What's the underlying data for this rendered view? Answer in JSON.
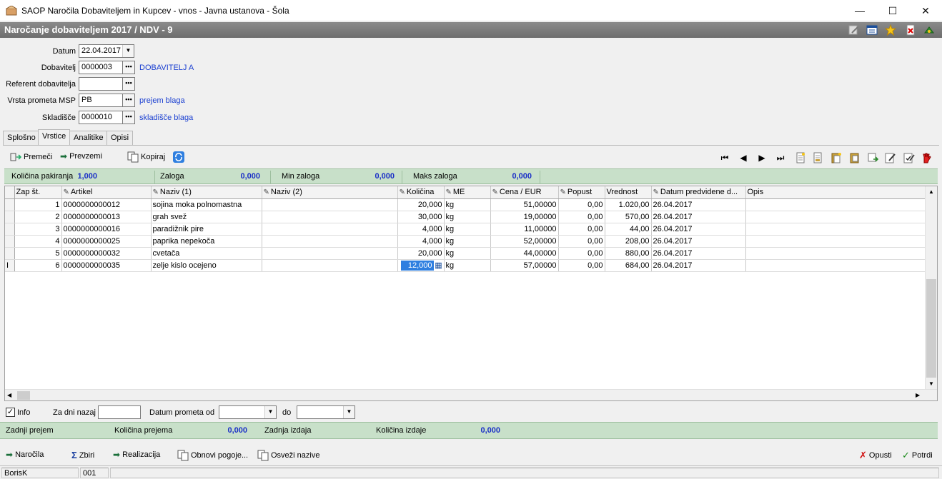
{
  "window": {
    "title": "SAOP  Naročila Dobaviteljem in Kupcev - vnos - Javna ustanova - Šola",
    "minimize": "—",
    "maximize": "☐",
    "close": "✕"
  },
  "header": {
    "title": "Naročanje dobaviteljem 2017 / NDV - 9"
  },
  "form": {
    "datum_label": "Datum",
    "datum_value": "22.04.2017",
    "dobavitelj_label": "Dobavitelj",
    "dobavitelj_value": "0000003",
    "dobavitelj_name": "DOBAVITELJ   A",
    "referent_label": "Referent dobavitelja",
    "referent_value": "",
    "vrsta_label": "Vrsta prometa MSP",
    "vrsta_value": "PB",
    "vrsta_name": "prejem blaga",
    "skladisce_label": "Skladišče",
    "skladisce_value": "0000010",
    "skladisce_name": "skladišče blaga",
    "dots": "•••"
  },
  "tabs": [
    "Splošno",
    "Vrstice",
    "Analitike",
    "Opisi"
  ],
  "toolbar": {
    "premeci": "Premeči",
    "prevzemi": "Prevzemi",
    "kopiraj": "Kopiraj"
  },
  "info": {
    "kolicina_pakiranja_label": "Količina pakiranja",
    "kolicina_pakiranja_value": "1,000",
    "zaloga_label": "Zaloga",
    "zaloga_value": "0,000",
    "min_zaloga_label": "Min zaloga",
    "min_zaloga_value": "0,000",
    "maks_zaloga_label": "Maks zaloga",
    "maks_zaloga_value": "0,000"
  },
  "grid": {
    "columns": [
      "Zap št.",
      "Artikel",
      "Naziv (1)",
      "Naziv (2)",
      "Količina",
      "ME",
      "Cena / EUR",
      "Popust",
      "Vrednost",
      "Datum predvidene d...",
      "Opis"
    ],
    "rows": [
      {
        "zap": "1",
        "artikel": "0000000000012",
        "naziv1": "sojina moka polnomastna",
        "naziv2": "",
        "kolicina": "20,000",
        "me": "kg",
        "cena": "51,00000",
        "popust": "0,00",
        "vrednost": "1.020,00",
        "datum": "26.04.2017",
        "opis": ""
      },
      {
        "zap": "2",
        "artikel": "0000000000013",
        "naziv1": "grah svež",
        "naziv2": "",
        "kolicina": "30,000",
        "me": "kg",
        "cena": "19,00000",
        "popust": "0,00",
        "vrednost": "570,00",
        "datum": "26.04.2017",
        "opis": ""
      },
      {
        "zap": "3",
        "artikel": "0000000000016",
        "naziv1": "paradižnik pire",
        "naziv2": "",
        "kolicina": "4,000",
        "me": "kg",
        "cena": "11,00000",
        "popust": "0,00",
        "vrednost": "44,00",
        "datum": "26.04.2017",
        "opis": ""
      },
      {
        "zap": "4",
        "artikel": "0000000000025",
        "naziv1": "paprika nepekoča",
        "naziv2": "",
        "kolicina": "4,000",
        "me": "kg",
        "cena": "52,00000",
        "popust": "0,00",
        "vrednost": "208,00",
        "datum": "26.04.2017",
        "opis": ""
      },
      {
        "zap": "5",
        "artikel": "0000000000032",
        "naziv1": "cvetača",
        "naziv2": "",
        "kolicina": "20,000",
        "me": "kg",
        "cena": "44,00000",
        "popust": "0,00",
        "vrednost": "880,00",
        "datum": "26.04.2017",
        "opis": ""
      },
      {
        "zap": "6",
        "artikel": "0000000000035",
        "naziv1": "zelje kislo ocejeno",
        "naziv2": "",
        "kolicina": "12,000",
        "me": "kg",
        "cena": "57,00000",
        "popust": "0,00",
        "vrednost": "684,00",
        "datum": "26.04.2017",
        "opis": ""
      }
    ]
  },
  "filter": {
    "info_label": "Info",
    "info_checked": true,
    "za_dni_nazaj_label": "Za dni nazaj",
    "za_dni_nazaj_value": "",
    "datum_od_label": "Datum prometa od",
    "datum_od_value": "",
    "do_label": "do",
    "do_value": ""
  },
  "info2": {
    "zadnji_prejem_label": "Zadnji prejem",
    "kolicina_prejema_label": "Količina prejema",
    "kolicina_prejema_value": "0,000",
    "zadnja_izdaja_label": "Zadnja izdaja",
    "kolicina_izdaje_label": "Količina izdaje",
    "kolicina_izdaje_value": "0,000"
  },
  "actions": {
    "narocila": "Naročila",
    "zbiri": "Zbiri",
    "realizacija": "Realizacija",
    "obnovi": "Obnovi pogoje...",
    "osvezi": "Osveži nazive",
    "opusti": "Opusti",
    "potrdi": "Potrdi"
  },
  "status": {
    "user": "BorisK",
    "code": "001"
  },
  "colors": {
    "green_strip": "#c8e0c9",
    "header_gray": "#7a7a7a",
    "link_blue": "#1a3fd1",
    "value_blue": "#1a2fc7",
    "edit_cell": "#2f7fe0"
  }
}
